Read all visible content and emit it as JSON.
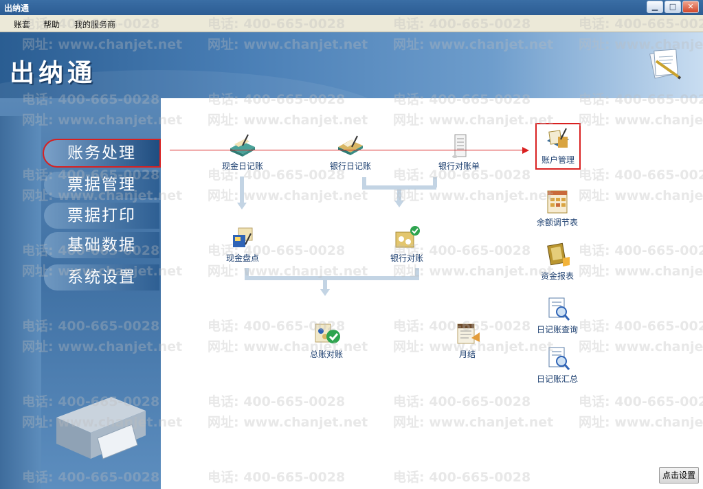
{
  "window": {
    "title": "出纳通",
    "controls": {
      "minimize": "▁",
      "maximize": "□",
      "close": "✕"
    }
  },
  "menu": {
    "items": [
      "账套",
      "帮助",
      "我的服务商"
    ]
  },
  "banner": {
    "app_name": "出纳通",
    "logo_icon": "notepad-pencil-icon"
  },
  "sidebar": {
    "items": [
      {
        "label": "账务处理",
        "active": true
      },
      {
        "label": "票据管理",
        "active": false
      },
      {
        "label": "票据打印",
        "active": false
      },
      {
        "label": "基础数据",
        "active": false
      },
      {
        "label": "系统设置",
        "active": false
      }
    ]
  },
  "functions": {
    "cash_journal": {
      "label": "现金日记账",
      "icon": "cash-journal-icon"
    },
    "bank_journal": {
      "label": "银行日记账",
      "icon": "bank-journal-icon"
    },
    "bank_statement": {
      "label": "银行对账单",
      "icon": "bank-statement-icon"
    },
    "cash_count": {
      "label": "现金盘点",
      "icon": "cash-count-icon"
    },
    "bank_reconcile": {
      "label": "银行对账",
      "icon": "bank-reconcile-icon"
    },
    "ledger_reconcile": {
      "label": "总账对账",
      "icon": "ledger-reconcile-icon"
    },
    "month_end": {
      "label": "月结",
      "icon": "month-end-icon"
    },
    "account_mgmt": {
      "label": "账户管理",
      "icon": "account-management-icon"
    },
    "balance_adjust": {
      "label": "余额调节表",
      "icon": "balance-adjustment-icon"
    },
    "fund_report": {
      "label": "资金报表",
      "icon": "fund-report-icon"
    },
    "journal_query": {
      "label": "日记账查询",
      "icon": "journal-query-icon"
    },
    "journal_summary": {
      "label": "日记账汇总",
      "icon": "journal-summary-icon"
    }
  },
  "watermark": {
    "phone": "电话: 400-665-0028",
    "site": "网址: www.chanjet.net"
  },
  "settings_button": {
    "label": "点击设置"
  },
  "colors": {
    "highlight": "#d92020",
    "link_text": "#1a3d6e",
    "banner": "#2a5d92"
  }
}
